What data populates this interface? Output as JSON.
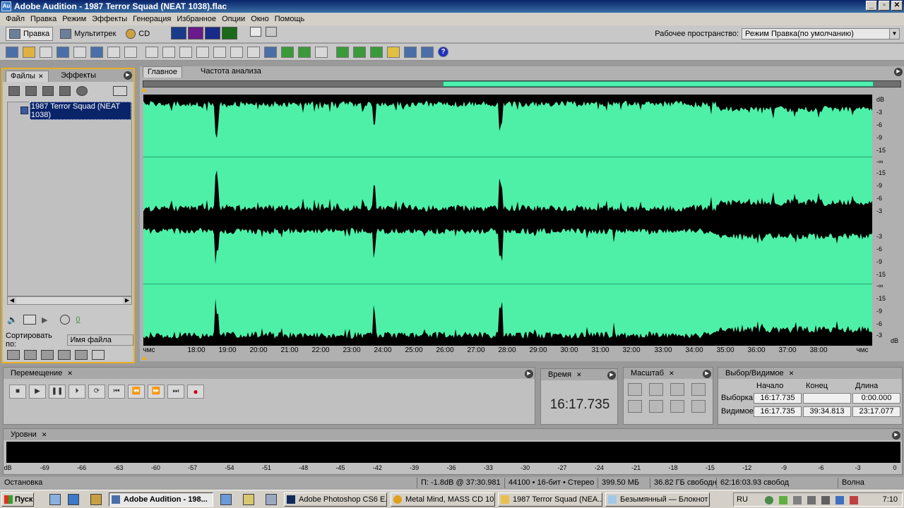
{
  "window": {
    "app_icon": "Au",
    "title": "Adobe Audition - 1987 Terror Squad (NEAT 1038).flac",
    "controls": [
      "_",
      "▫",
      "✕"
    ]
  },
  "menu": [
    "Файл",
    "Правка",
    "Режим",
    "Эффекты",
    "Генерация",
    "Избранное",
    "Опции",
    "Окно",
    "Помощь"
  ],
  "modes": {
    "edit": "Правка",
    "multitrack": "Мультитрек",
    "cd": "CD"
  },
  "workspace": {
    "label": "Рабочее пространство:",
    "value": "Режим Правка(по умолчанию)"
  },
  "left_panel": {
    "tabs": [
      "Файлы",
      "Эффекты"
    ],
    "files": [
      "1987 Terror Squad (NEAT 1038)"
    ],
    "volume_value": "0",
    "sort_label": "Сортировать по:",
    "sort_value": "Имя файла"
  },
  "editor": {
    "tabs": [
      "Главное",
      "Частота анализа"
    ],
    "db_labels_top": [
      "dB",
      "-3",
      "-6",
      "-9",
      "-15",
      "-∞",
      "-15",
      "-9",
      "-6",
      "-3"
    ],
    "db_labels_bottom": [
      "-3",
      "-6",
      "-9",
      "-15",
      "-∞",
      "-15",
      "-9",
      "-6",
      "-3",
      "dB"
    ],
    "time_ticks": [
      "чмс",
      "18:00",
      "19:00",
      "20:00",
      "21:00",
      "22:00",
      "23:00",
      "24:00",
      "25:00",
      "26:00",
      "27:00",
      "28:00",
      "29:00",
      "30:00",
      "31:00",
      "32:00",
      "33:00",
      "34:00",
      "35:00",
      "36:00",
      "37:00",
      "38:00",
      "чмс"
    ],
    "colors": {
      "waveform_bg": "#4ef0a8",
      "waveform": "#000000",
      "overview_range": "#4ef0b0"
    }
  },
  "transport": {
    "title": "Перемещение",
    "buttons": [
      "■",
      "▶",
      "❚❚",
      "⏵",
      "⟳",
      "⏮",
      "⏪",
      "⏩",
      "⏭",
      "●"
    ]
  },
  "time": {
    "title": "Время",
    "value": "16:17.735"
  },
  "zoom": {
    "title": "Масштаб"
  },
  "selection": {
    "title": "Выбор/Видимое",
    "headers": [
      "Начало",
      "Конец",
      "Длина"
    ],
    "rows": [
      {
        "label": "Выборка",
        "start": "16:17.735",
        "end": "",
        "length": "0:00.000"
      },
      {
        "label": "Видимое",
        "start": "16:17.735",
        "end": "39:34.813",
        "length": "23:17.077"
      }
    ]
  },
  "levels": {
    "title": "Уровни",
    "scale": [
      "dB",
      "-69",
      "-66",
      "-63",
      "-60",
      "-57",
      "-54",
      "-51",
      "-48",
      "-45",
      "-42",
      "-39",
      "-36",
      "-33",
      "-30",
      "-27",
      "-24",
      "-21",
      "-18",
      "-15",
      "-12",
      "-9",
      "-6",
      "-3",
      "0"
    ]
  },
  "status": {
    "state": "Остановка",
    "peak": "П: -1.8dB @  37:30.981",
    "format": "44100 • 16-бит • Стерео",
    "size": "399.50 МБ",
    "free": "36.82 ГБ свободн",
    "free_time": "62:16:03.93 свобод",
    "view": "Волна"
  },
  "taskbar": {
    "start": "Пуск",
    "tasks": [
      "Adobe Audition - 198...",
      "Adobe Photoshop CS6 E...",
      "Metal Mind, MASS CD 10...",
      "1987 Terror Squad (NEA...",
      "Безымянный — Блокнот"
    ],
    "lang": "RU",
    "clock": "7:10"
  }
}
